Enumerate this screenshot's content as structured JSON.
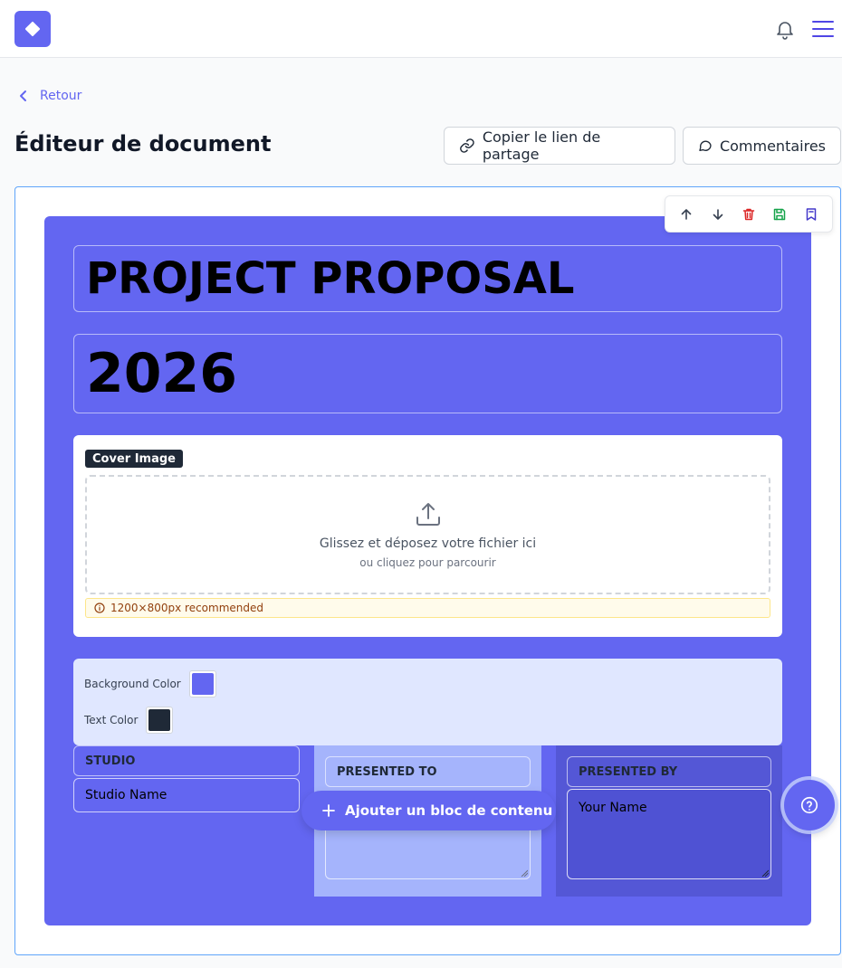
{
  "colors": {
    "accent": "#6366f1",
    "background_swatch": "#6366f1",
    "text_swatch": "#1f2937",
    "delete": "#dc2626",
    "save": "#16a34a",
    "template": "#4338ca"
  },
  "nav": {
    "logo_icon": "diamond-logo-icon",
    "back_label": "Retour"
  },
  "header": {
    "title": "Éditeur de document",
    "share_label": "Copier le lien de partage",
    "comments_label": "Commentaires"
  },
  "cover": {
    "title": "PROJECT PROPOSAL",
    "year": "2026",
    "image_badge": "Cover Image",
    "dropzone_main": "Glissez et déposez votre fichier ici",
    "dropzone_sub": "ou cliquez pour parcourir",
    "image_hint": "1200×800px recommended",
    "background_color_label": "Background Color",
    "text_color_label": "Text Color",
    "studio_label": "STUDIO",
    "studio_value": "Studio Name",
    "presented_to_label": "PRESENTED TO",
    "presented_by_label": "PRESENTED BY",
    "presented_by_value": "Your Name"
  },
  "actions": {
    "add_block_label": "Ajouter un bloc de contenu"
  }
}
